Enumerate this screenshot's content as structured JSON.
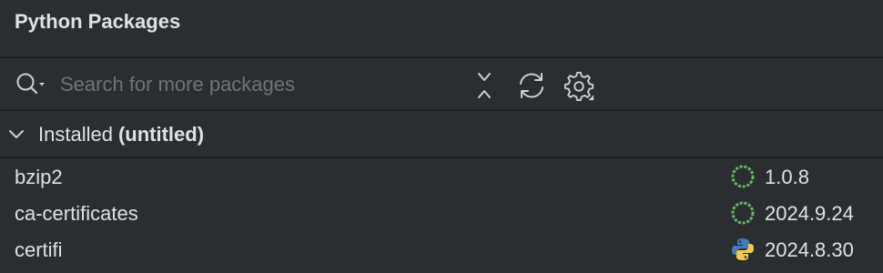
{
  "panel": {
    "title": "Python Packages"
  },
  "toolbar": {
    "search_placeholder": "Search for more packages",
    "icons": [
      "search-icon",
      "collapse-icon",
      "refresh-icon",
      "settings-icon"
    ]
  },
  "installed_group": {
    "label": "Installed",
    "environment": "(untitled)",
    "expanded": true
  },
  "packages": [
    {
      "name": "bzip2",
      "version": "1.0.8",
      "source_icon": "conda-icon"
    },
    {
      "name": "ca-certificates",
      "version": "2024.9.24",
      "source_icon": "conda-icon"
    },
    {
      "name": "certifi",
      "version": "2024.8.30",
      "source_icon": "python-icon"
    }
  ],
  "colors": {
    "background": "#2b2d30",
    "divider": "#1e1f22",
    "text": "#dfe1e5",
    "placeholder": "#6f737a",
    "conda_green": "#5fb865",
    "python_blue": "#3f7cc0",
    "python_yellow": "#f2c94c"
  }
}
